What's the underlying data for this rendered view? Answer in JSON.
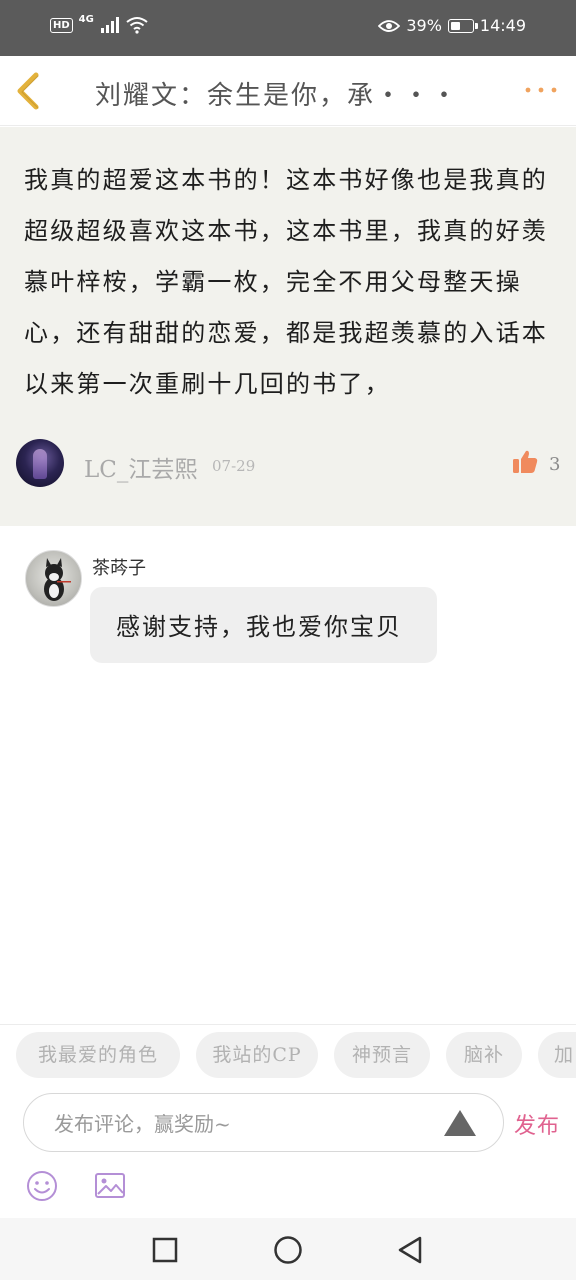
{
  "status_bar": {
    "hd": "HD",
    "network": "4G",
    "battery_text": "39%",
    "battery_level": 0.39,
    "time": "14:49"
  },
  "header": {
    "title": "刘耀文：余生是你，承・・・",
    "back_icon": "chevron-left-icon",
    "more_icon": "more-dots-icon",
    "accent_color": "#e3b23c",
    "more_color": "#f0a35e"
  },
  "comment": {
    "text": "我真的超爱这本书的！这本书好像也是我真的超级超级喜欢这本书，这本书里，我真的好羡慕叶梓桉，学霸一枚，完全不用父母整天操心，还有甜甜的恋爱，都是我超羡慕的入话本以来第一次重刷十几回的书了，",
    "author": "LC_江芸熙",
    "date": "07-29",
    "likes": "3",
    "like_icon": "thumbs-up-icon",
    "like_color": "#f08a5d"
  },
  "reply": {
    "author": "茶荶子",
    "text": "感谢支持，我也爱你宝贝"
  },
  "chips": [
    "我最爱的角色",
    "我站的CP",
    "神预言",
    "脑补",
    "加"
  ],
  "input": {
    "placeholder": "发布评论，赢奖励~",
    "value": "",
    "send_icon": "triangle-send-icon"
  },
  "publish_label": "发布",
  "publish_color": "#e0628f",
  "toolbar_icons": [
    "emoji-icon",
    "image-icon"
  ],
  "toolbar_icon_color": "#b48fd6",
  "nav": [
    "recents-square-icon",
    "home-circle-icon",
    "back-triangle-icon"
  ]
}
